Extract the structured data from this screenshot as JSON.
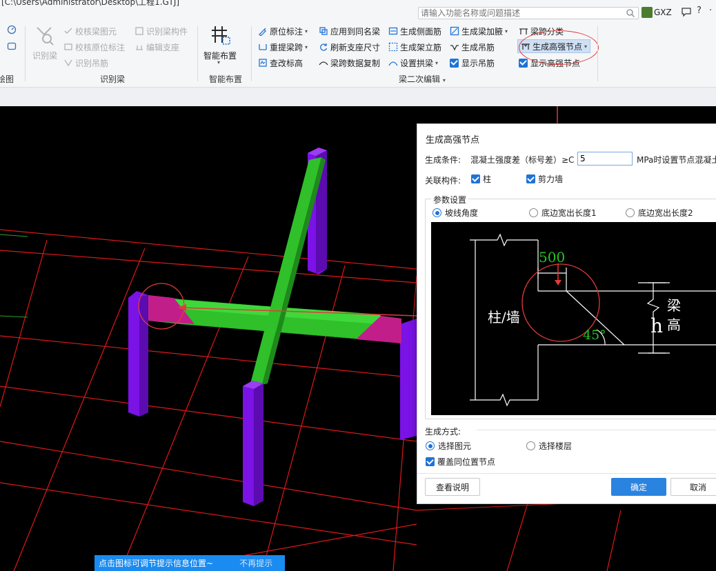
{
  "title_bar": {
    "path": "[C:\\Users\\Administrator\\Desktop\\工程1.GTJ]",
    "search_placeholder": "请输入功能名称或问题描述",
    "user": "GXZ",
    "help": "?",
    "more": "·"
  },
  "ribbon": {
    "left_group_label": "绘图",
    "recognize": {
      "big_button": "识别梁",
      "items": [
        "校核梁图元",
        "校核原位标注",
        "识别吊筋",
        "识别梁构件",
        "编辑支座"
      ],
      "group_label": "识别梁"
    },
    "smart": {
      "big_button": "智能布置",
      "group_label": "智能布置"
    },
    "edit": {
      "col1": [
        "原位标注",
        "重提梁跨",
        "查改标高"
      ],
      "col2": [
        "应用到同名梁",
        "刷新支座尺寸",
        "梁跨数据复制"
      ],
      "col3": [
        "生成侧面筋",
        "生成架立筋",
        "设置拱梁"
      ],
      "col4": [
        "生成梁加腋",
        "生成吊筋",
        "显示吊筋"
      ],
      "col5": [
        "梁跨分类",
        "生成高强节点",
        "显示高强节点"
      ],
      "group_label": "梁二次编辑"
    }
  },
  "dialog": {
    "title": "生成高强节点",
    "condition_label": "生成条件:",
    "condition_text": "混凝土强度差（标号差）≥C",
    "condition_value": "5",
    "condition_suffix": "MPa时设置节点混凝土",
    "related_label": "关联构件:",
    "related_column": "柱",
    "related_shearwall": "剪力墙",
    "params_legend": "参数设置",
    "param_options": [
      "坡线角度",
      "底边宽出长度1",
      "底边宽出长度2"
    ],
    "diagram": {
      "dimension": "500",
      "angle": "45°",
      "column_label": "柱/墙",
      "h_label": "h",
      "beam_label_1": "梁",
      "beam_label_2": "高"
    },
    "method_label": "生成方式:",
    "method_options": [
      "选择图元",
      "选择楼层"
    ],
    "overwrite_label": "覆盖同位置节点",
    "buttons": {
      "help": "查看说明",
      "ok": "确定",
      "cancel": "取消"
    }
  },
  "tip": {
    "text": "点击图标可调节提示信息位置~",
    "dismiss": "不再提示"
  },
  "colors": {
    "column": "#7b12e6",
    "beam": "#2fc02a",
    "node": "#c21e8a",
    "grid": "#e01818",
    "annotation": "#e23b3b",
    "accent": "#1f73d6"
  }
}
